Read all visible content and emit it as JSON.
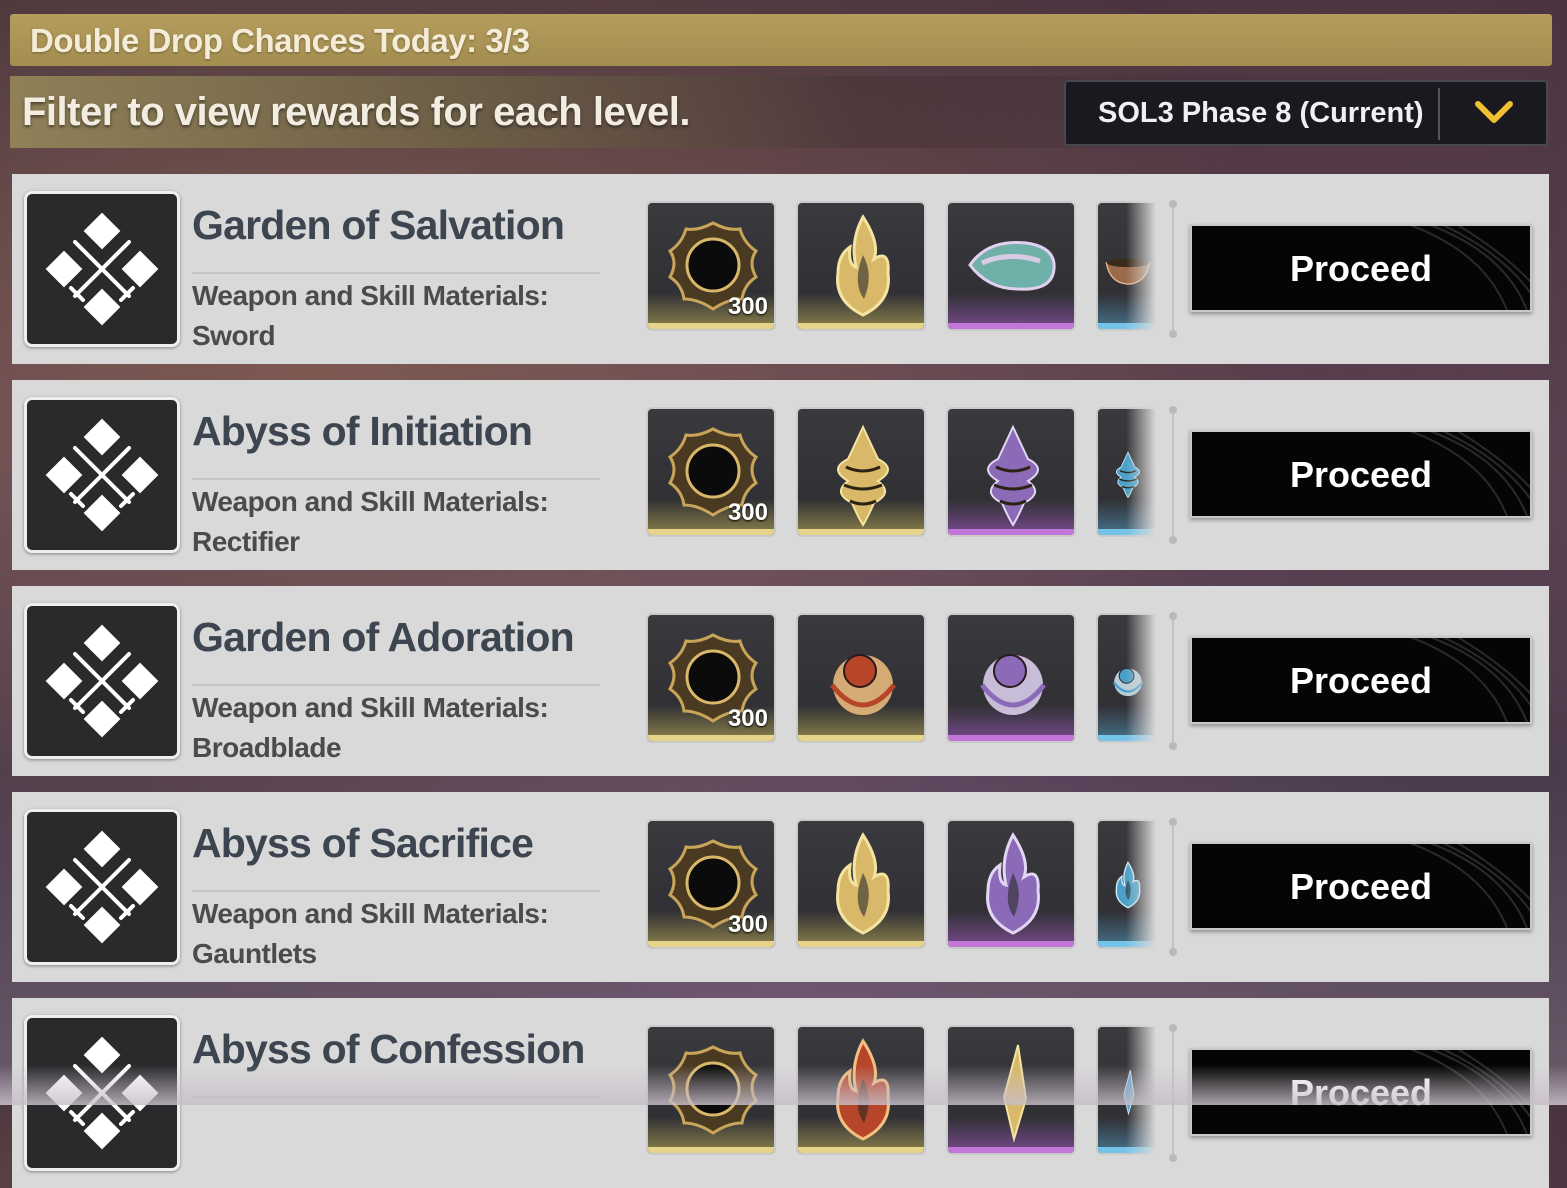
{
  "header": {
    "double_drop": "Double Drop Chances Today: 3/3",
    "filter_prompt": "Filter to view rewards for each level.",
    "dropdown_value": "SOL3 Phase 8 (Current)",
    "dropdown_icon": "chevron-down-icon"
  },
  "colors": {
    "banner": "#b49d5d",
    "card_bg": "#d9d9d9",
    "button_bg": "#050505",
    "chevron": "#f0c030",
    "rarity_gold": "#e6d48a",
    "rarity_purple": "#c277d8",
    "rarity_blue": "#74c4ea"
  },
  "levels": [
    {
      "title": "Garden of Salvation",
      "subtitle_line1": "Weapon and Skill Materials:",
      "subtitle_line2": "Sword",
      "reward_qty": "300",
      "rewards": [
        "black-shell-icon",
        "flame-crystal-icon",
        "iridescent-stone-icon",
        "bowl-icon"
      ],
      "button": "Proceed"
    },
    {
      "title": "Abyss of Initiation",
      "subtitle_line1": "Weapon and Skill Materials:",
      "subtitle_line2": "Rectifier",
      "reward_qty": "300",
      "rewards": [
        "black-shell-icon",
        "spiral-shell-gold-icon",
        "spiral-shell-purple-icon",
        "spiral-shell-blue-icon"
      ],
      "button": "Proceed"
    },
    {
      "title": "Garden of Adoration",
      "subtitle_line1": "Weapon and Skill Materials:",
      "subtitle_line2": "Broadblade",
      "reward_qty": "300",
      "rewards": [
        "black-shell-icon",
        "ruby-orb-icon",
        "amethyst-orb-icon",
        "sapphire-orb-icon"
      ],
      "button": "Proceed"
    },
    {
      "title": "Abyss of Sacrifice",
      "subtitle_line1": "Weapon and Skill Materials:",
      "subtitle_line2": "Gauntlets",
      "reward_qty": "300",
      "rewards": [
        "black-shell-icon",
        "gold-flame-icon",
        "purple-flame-icon",
        "blue-flame-icon"
      ],
      "button": "Proceed"
    },
    {
      "title": "Abyss of Confession",
      "reward_qty": "",
      "rewards": [
        "black-shell-icon",
        "red-flame-icon",
        "gold-shard-icon",
        "blue-shard-icon"
      ],
      "button": "Proceed"
    }
  ]
}
